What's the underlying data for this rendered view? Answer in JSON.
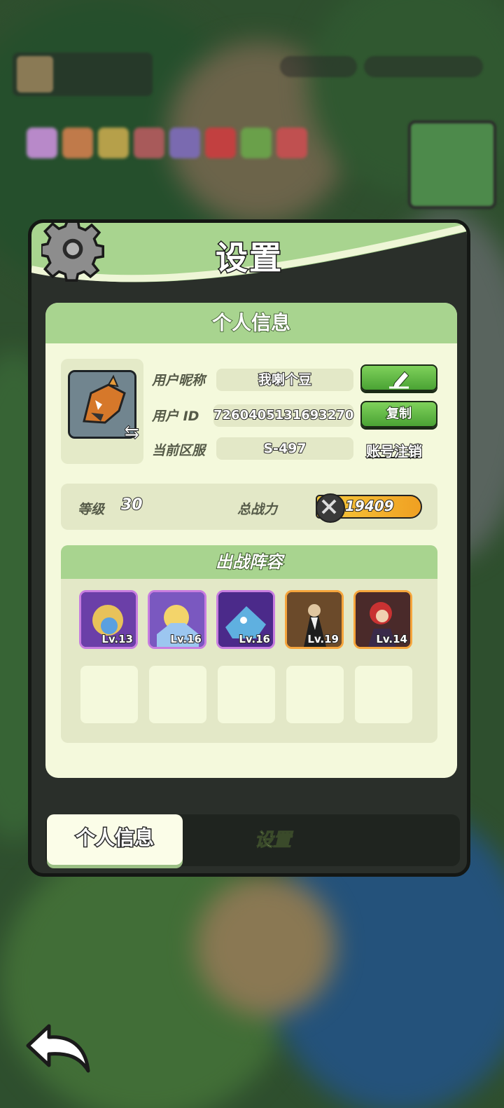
{
  "panel": {
    "title": "设置",
    "info_section_title": "个人信息",
    "profile": {
      "nickname_label": "用户昵称",
      "nickname": "我喇个豆",
      "id_label": "用户 ID",
      "user_id": "7260405131693270",
      "server_label": "当前区服",
      "server": "S-497",
      "copy_button": "复制",
      "cancel_account_link": "账号注销",
      "edit_icon": "pencil-icon",
      "swap_icon": "swap-arrows-icon"
    },
    "stats": {
      "level_label": "等级",
      "level": "30",
      "power_label": "总战力",
      "power": "19409"
    },
    "lineup": {
      "title": "出战阵容",
      "heroes": [
        {
          "level": "Lv.13",
          "rarity": "purple"
        },
        {
          "level": "Lv.16",
          "rarity": "purple"
        },
        {
          "level": "Lv.16",
          "rarity": "purple"
        },
        {
          "level": "Lv.19",
          "rarity": "orange"
        },
        {
          "level": "Lv.14",
          "rarity": "orange"
        }
      ],
      "empty_slots": 5
    },
    "tabs": {
      "active": "个人信息",
      "inactive": "设置"
    }
  },
  "colors": {
    "accent_green": "#a8d48f",
    "button_green": "#5cb83f",
    "card_bg": "#f4f9dc",
    "power_gold": "#f5c93c"
  }
}
